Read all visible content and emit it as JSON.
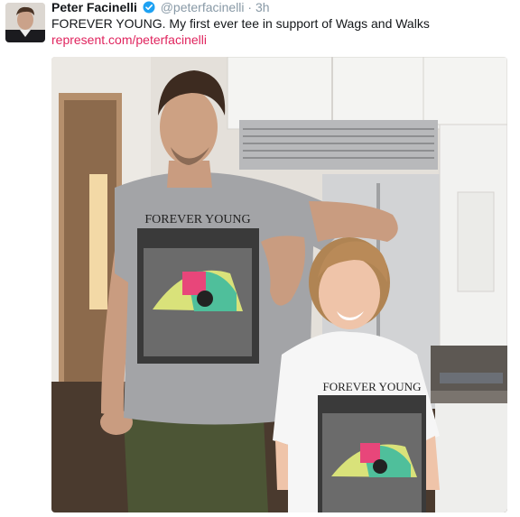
{
  "tweet": {
    "author_name": "Peter Facinelli",
    "handle": "@peterfacinelli",
    "separator": "·",
    "time": "3h",
    "text": "FOREVER YOUNG. My first ever tee in support of Wags and Walks",
    "link_text": "represent.com/peterfacinelli"
  },
  "photo": {
    "shirt_text_adult": "FOREVER YOUNG",
    "shirt_text_child": "FOREVER YOUNG"
  },
  "colors": {
    "link": "#e0245e",
    "verified": "#1da1f2",
    "meta": "#8899a6"
  }
}
